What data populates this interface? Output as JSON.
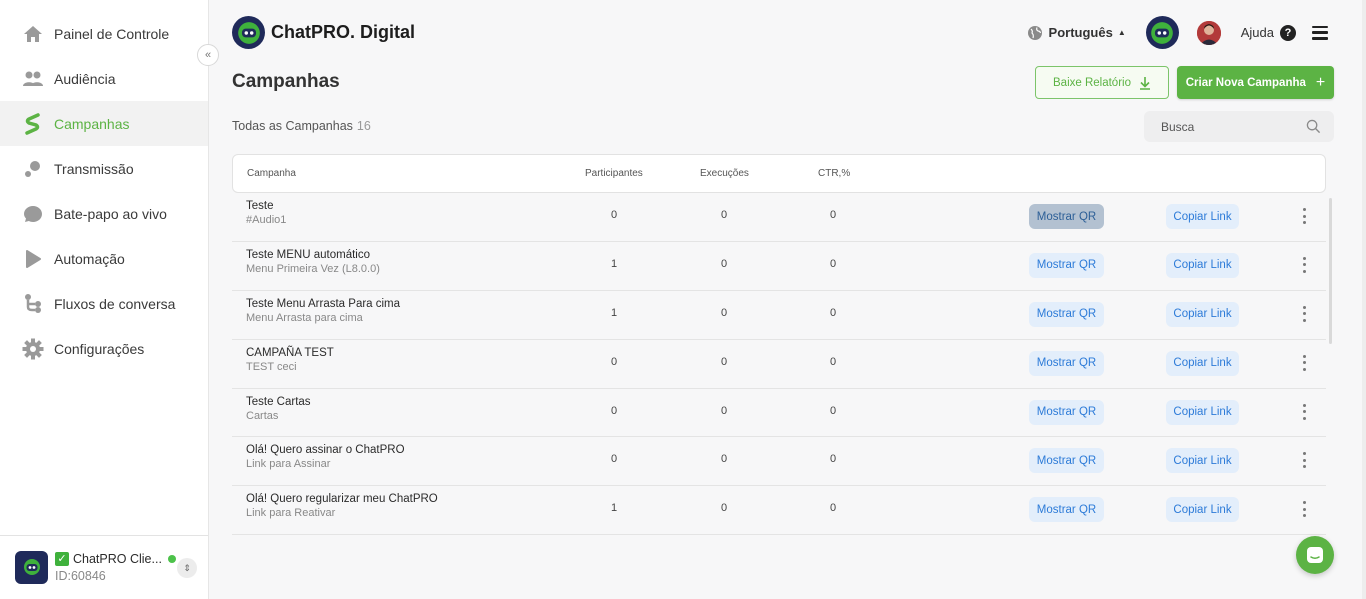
{
  "sidebar": {
    "items": [
      {
        "label": "Painel de Controle",
        "icon": "home-icon"
      },
      {
        "label": "Audiência",
        "icon": "people-icon"
      },
      {
        "label": "Campanhas",
        "icon": "campaign-icon",
        "active": true
      },
      {
        "label": "Transmissão",
        "icon": "broadcast-icon"
      },
      {
        "label": "Bate-papo ao vivo",
        "icon": "chat-bubble-icon"
      },
      {
        "label": "Automação",
        "icon": "play-icon"
      },
      {
        "label": "Fluxos de conversa",
        "icon": "flow-icon"
      },
      {
        "label": "Configurações",
        "icon": "gear-icon"
      }
    ],
    "collapse_glyph": "«",
    "account": {
      "name": "ChatPRO Clie...",
      "id": "ID:60846",
      "check": "✓",
      "switch_glyph": "⇕"
    }
  },
  "header": {
    "brand": "ChatPRO. Digital",
    "language": "Português",
    "help": "Ajuda",
    "help_glyph": "?"
  },
  "main": {
    "title": "Campanhas",
    "report_button": "Baixe Relatório",
    "create_button": "Criar Nova Campanha",
    "create_glyph": "+",
    "all_label": "Todas as Campanhas",
    "all_count": "16",
    "search_placeholder": "Busca"
  },
  "table": {
    "columns": [
      "Campanha",
      "Participantes",
      "Execuções",
      "CTR,%"
    ],
    "qr_label": "Mostrar QR",
    "link_label": "Copiar Link",
    "rows": [
      {
        "name": "Teste",
        "sub": "#Audio1",
        "participants": "0",
        "executions": "0",
        "ctr": "0"
      },
      {
        "name": "Teste MENU automático",
        "sub": "Menu Primeira Vez (L8.0.0)",
        "participants": "1",
        "executions": "0",
        "ctr": "0"
      },
      {
        "name": "Teste Menu Arrasta Para cima",
        "sub": "Menu Arrasta para cima",
        "participants": "1",
        "executions": "0",
        "ctr": "0"
      },
      {
        "name": "CAMPAÑA TEST",
        "sub": "TEST ceci",
        "participants": "0",
        "executions": "0",
        "ctr": "0"
      },
      {
        "name": "Teste Cartas",
        "sub": "Cartas",
        "participants": "0",
        "executions": "0",
        "ctr": "0"
      },
      {
        "name": "Olá! Quero assinar o ChatPRO",
        "sub": "Link para Assinar",
        "participants": "0",
        "executions": "0",
        "ctr": "0"
      },
      {
        "name": "Olá! Quero regularizar meu ChatPRO",
        "sub": "Link para Reativar",
        "participants": "1",
        "executions": "0",
        "ctr": "0"
      }
    ]
  },
  "colors": {
    "accent": "#5cb344",
    "link": "#2d7bd8",
    "navy": "#1f2a5a"
  }
}
